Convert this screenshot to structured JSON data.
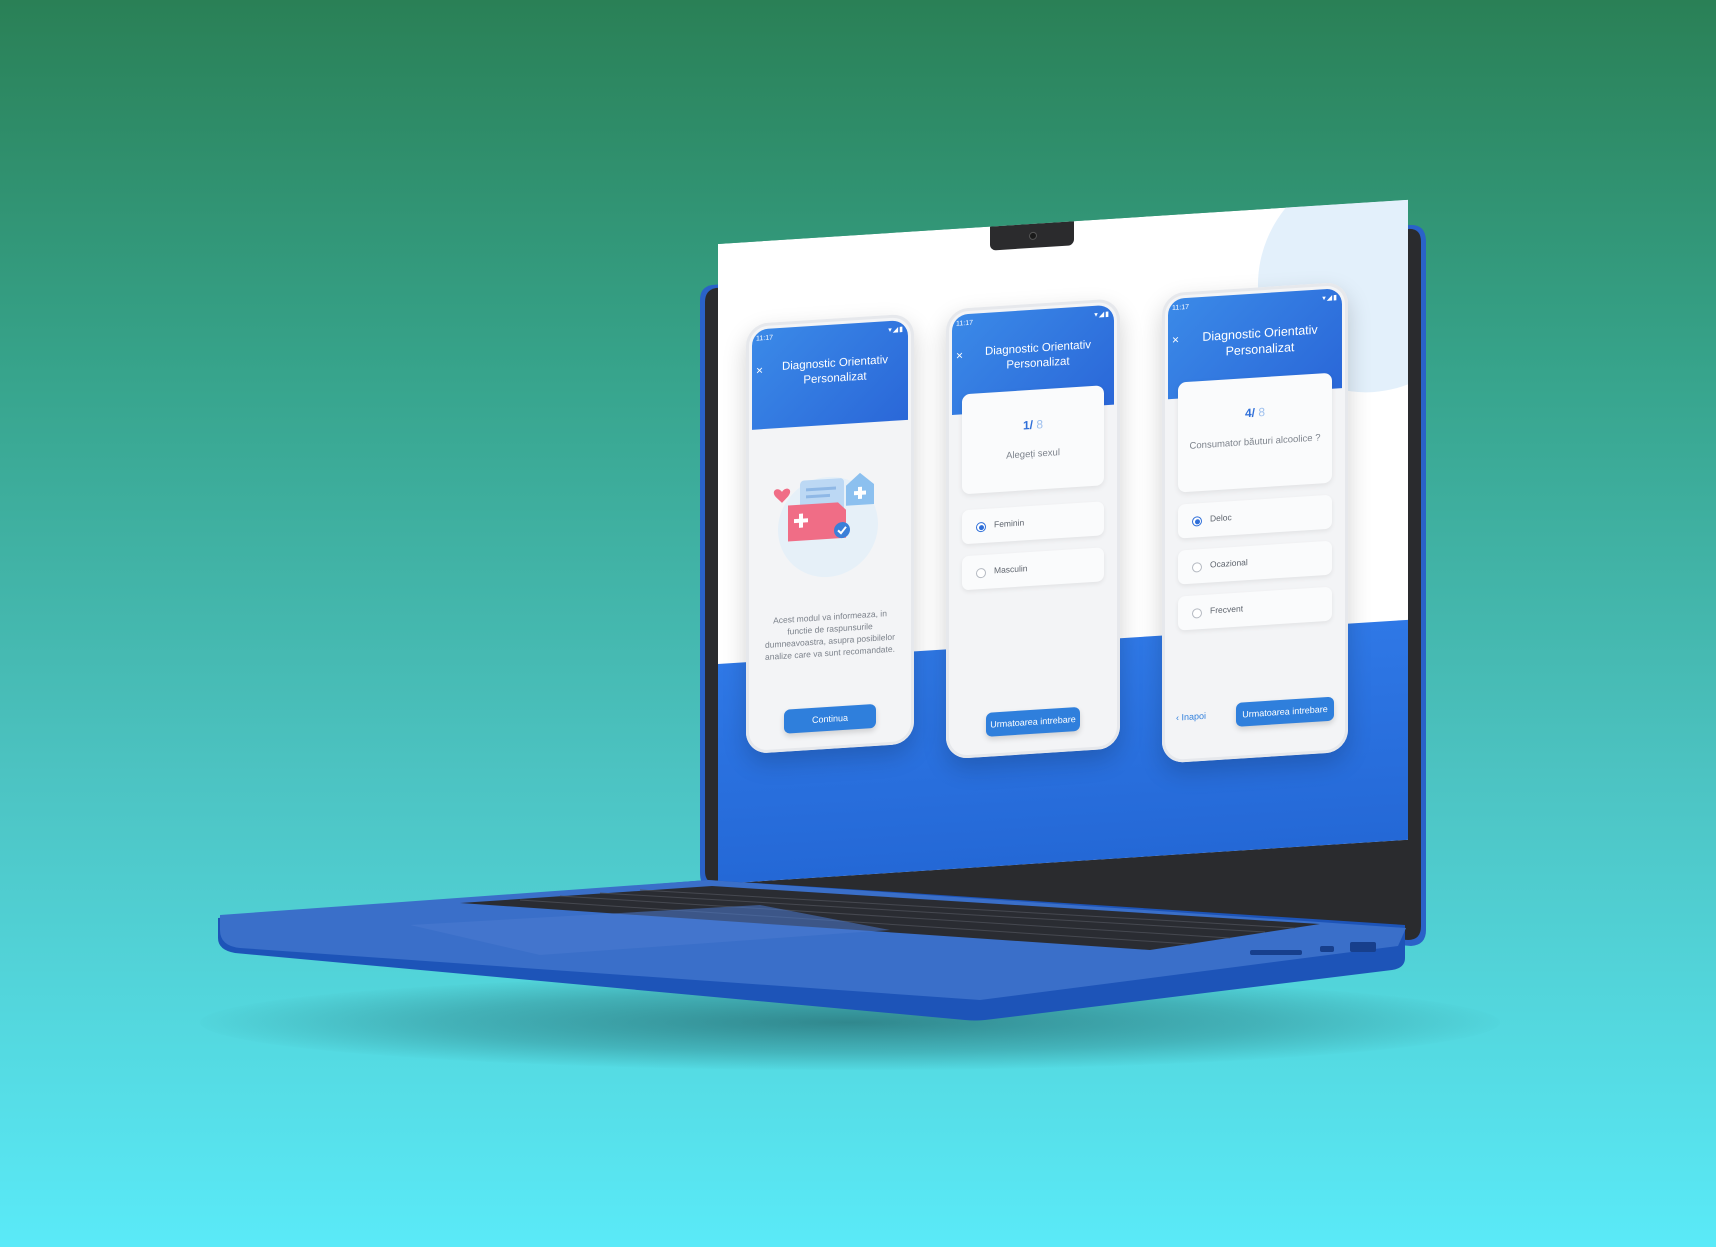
{
  "app": {
    "title": "Diagnostic Orientativ Personalizat",
    "status_time": "11:17",
    "accent_color": "#2f7fdc"
  },
  "screens": {
    "intro": {
      "title_line1": "Diagnostic Orientativ",
      "title_line2": "Personalizat",
      "close_icon": "×",
      "description": "Acest modul va informeaza, in functie de raspunsurile dumneavoastra, asupra posibilelor analize care va sunt recomandate.",
      "continue_label": "Continua"
    },
    "question1": {
      "title_line1": "Diagnostic Orientativ",
      "title_line2": "Personalizat",
      "close_icon": "×",
      "current": "1",
      "total": " 8",
      "separator": "/",
      "question": "Alegeți sexul",
      "options": [
        {
          "label": "Feminin",
          "selected": true
        },
        {
          "label": "Masculin",
          "selected": false
        }
      ],
      "next_label": "Urmatoarea intrebare"
    },
    "question4": {
      "title_line1": "Diagnostic Orientativ",
      "title_line2": "Personalizat",
      "close_icon": "×",
      "current": "4",
      "total": " 8",
      "separator": "/",
      "question": "Consumator băuturi alcoolice ?",
      "options": [
        {
          "label": "Deloc",
          "selected": true
        },
        {
          "label": "Ocazional",
          "selected": false
        },
        {
          "label": "Frecvent",
          "selected": false
        }
      ],
      "back_label": "Inapoi",
      "next_label": "Urmatoarea intrebare"
    }
  }
}
